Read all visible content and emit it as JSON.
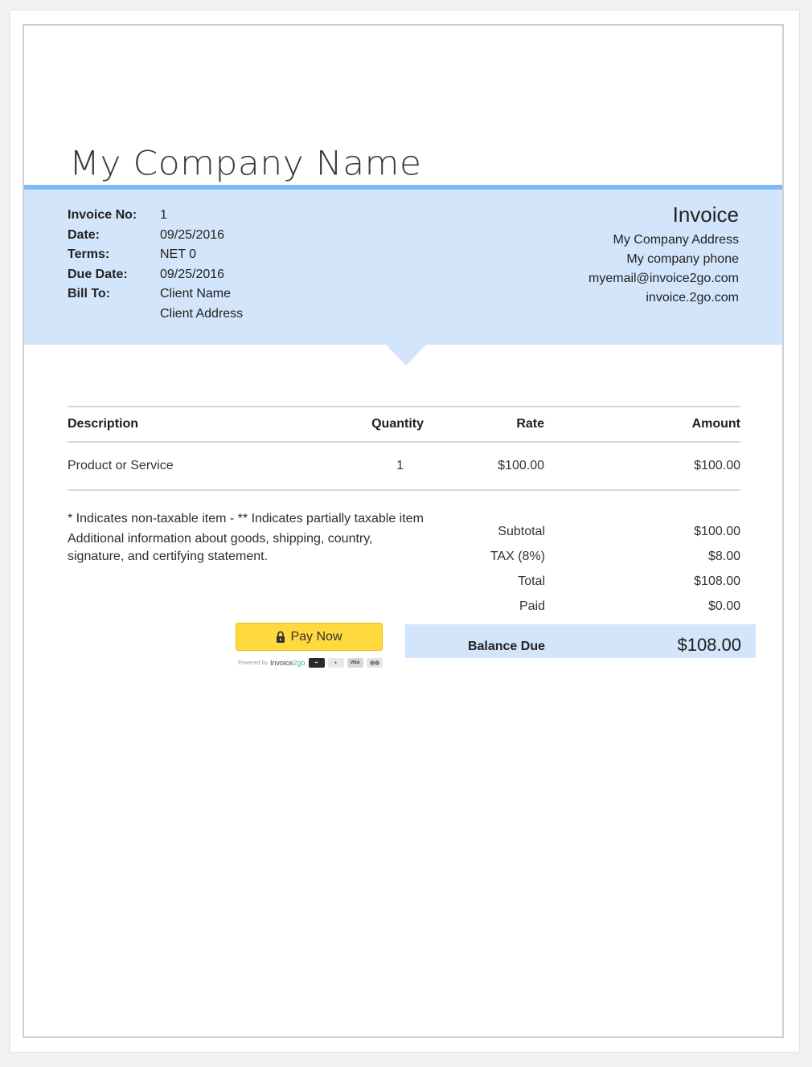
{
  "company": {
    "name": "My Company Name"
  },
  "invoice_meta": [
    {
      "label": "Invoice No:",
      "value": "1"
    },
    {
      "label": "Date:",
      "value": "09/25/2016"
    },
    {
      "label": "Terms:",
      "value": "NET 0"
    },
    {
      "label": "Due Date:",
      "value": "09/25/2016"
    },
    {
      "label": "Bill To:",
      "value": "Client Name"
    }
  ],
  "bill_to_address": "Client Address",
  "from": {
    "title": "Invoice",
    "address": "My Company Address",
    "phone": "My company phone",
    "email": "myemail@invoice2go.com",
    "website": "invoice.2go.com"
  },
  "table": {
    "headers": {
      "description": "Description",
      "quantity": "Quantity",
      "rate": "Rate",
      "amount": "Amount"
    },
    "rows": [
      {
        "description": "Product or Service",
        "quantity": "1",
        "rate": "$100.00",
        "amount": "$100.00"
      }
    ]
  },
  "notes": {
    "tax_note": "* Indicates non-taxable item - ** Indicates partially taxable item",
    "additional": "Additional information about goods, shipping, country, signature, and certifying statement."
  },
  "totals": [
    {
      "label": "Subtotal",
      "value": "$100.00"
    },
    {
      "label": "TAX (8%)",
      "value": "$8.00"
    },
    {
      "label": "Total",
      "value": "$108.00"
    },
    {
      "label": "Paid",
      "value": "$0.00"
    }
  ],
  "balance_due": {
    "label": "Balance Due",
    "value": "$108.00"
  },
  "payment": {
    "button_label": "Pay Now",
    "powered_by": "Powered by",
    "brand": "Invoice",
    "brand_suffix": "2go",
    "cards": [
      "amex",
      "discover",
      "visa",
      "mastercard"
    ],
    "visa_text": "VISA"
  },
  "colors": {
    "band": "#d3e5fb",
    "band_border": "#7eb8f7",
    "pay_button": "#ffd93d"
  }
}
